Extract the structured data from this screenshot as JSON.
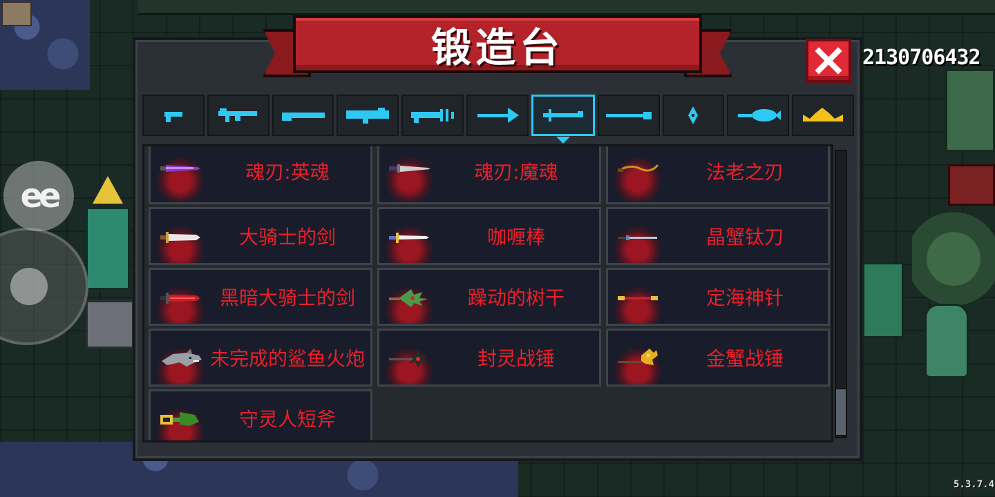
{
  "hud": {
    "gem_count": "2130706432",
    "version": "5.3.7.4"
  },
  "joystick": {
    "emote_label": "ee"
  },
  "forge": {
    "title": "锻造台",
    "close_icon": "close-x-icon",
    "categories": [
      {
        "icon": "pistol-icon",
        "color": "#2fc8f2",
        "active": false
      },
      {
        "icon": "assault-rifle-icon",
        "color": "#2fc8f2",
        "active": false
      },
      {
        "icon": "shotgun-icon",
        "color": "#2fc8f2",
        "active": false
      },
      {
        "icon": "launcher-icon",
        "color": "#2fc8f2",
        "active": false
      },
      {
        "icon": "laser-gun-icon",
        "color": "#2fc8f2",
        "active": false
      },
      {
        "icon": "bow-icon",
        "color": "#2fc8f2",
        "active": false
      },
      {
        "icon": "melee-sword-icon",
        "color": "#2fc8f2",
        "active": true
      },
      {
        "icon": "spear-icon",
        "color": "#2fc8f2",
        "active": false
      },
      {
        "icon": "throwing-star-icon",
        "color": "#2fc8f2",
        "active": false
      },
      {
        "icon": "fish-staff-icon",
        "color": "#2fc8f2",
        "active": false
      },
      {
        "icon": "crown-icon",
        "color": "#f2c21b",
        "active": false
      }
    ],
    "weapons": [
      {
        "name": "魂刃:英魂",
        "icon": "purple-sword-icon"
      },
      {
        "name": "魂刃:魔魂",
        "icon": "purple-dagger-icon"
      },
      {
        "name": "法老之刃",
        "icon": "curved-blade-icon"
      },
      {
        "name": "大骑士的剑",
        "icon": "great-sword-icon"
      },
      {
        "name": "咖喱棒",
        "icon": "excalibur-icon"
      },
      {
        "name": "晶蟹钛刀",
        "icon": "crystal-blade-icon"
      },
      {
        "name": "黑暗大骑士的剑",
        "icon": "dark-great-sword-icon"
      },
      {
        "name": "躁动的树干",
        "icon": "tree-trunk-icon"
      },
      {
        "name": "定海神针",
        "icon": "golden-staff-icon"
      },
      {
        "name": "未完成的鲨鱼火炮",
        "icon": "shark-cannon-icon"
      },
      {
        "name": "封灵战锤",
        "icon": "spiked-hammer-icon"
      },
      {
        "name": "金蟹战锤",
        "icon": "gold-crab-hammer-icon"
      },
      {
        "name": "守灵人短斧",
        "icon": "guardian-axe-icon"
      }
    ]
  }
}
